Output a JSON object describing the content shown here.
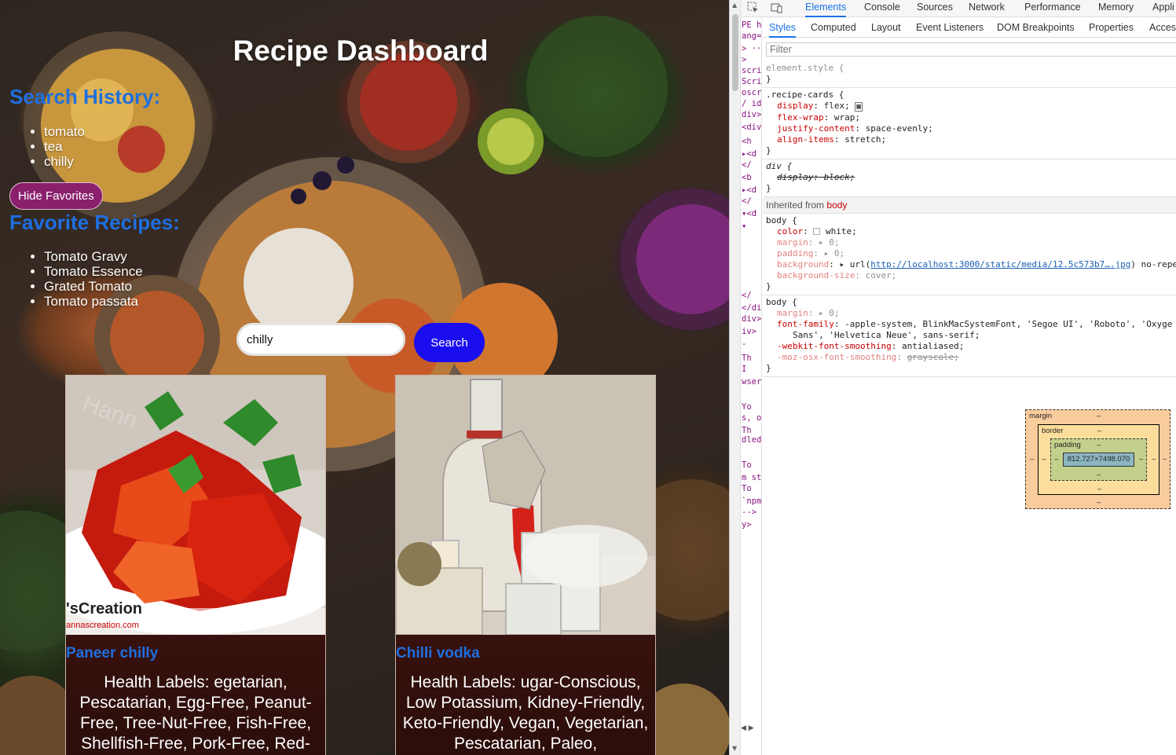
{
  "app": {
    "title": "Recipe Dashboard",
    "search_history": {
      "heading": "Search History:",
      "items": [
        "tomato",
        "tea",
        "chilly"
      ]
    },
    "hide_favorites_label": "Hide Favorites",
    "favorites": {
      "heading": "Favorite Recipes:",
      "items": [
        "Tomato Gravy",
        "Tomato Essence",
        "Grated Tomato",
        "Tomato passata"
      ]
    },
    "search": {
      "value": "chilly",
      "button_label": "Search"
    },
    "cards": [
      {
        "name": "Paneer chilly",
        "health_labels": "Health Labels: egetarian, Pescatarian, Egg-Free, Peanut-Free, Tree-Nut-Free, Fish-Free, Shellfish-Free, Pork-Free, Red-",
        "watermark_top": "Hann",
        "watermark_bottom": "'sCreation",
        "watermark_url": "annascreation.com"
      },
      {
        "name": "Chilli vodka",
        "health_labels": "Health Labels: ugar-Conscious, Low Potassium, Kidney-Friendly, Keto-Friendly, Vegan, Vegetarian, Pescatarian, Paleo,"
      }
    ],
    "colors": {
      "heading_blue": "#1e6fe0",
      "search_button": "#1a0ef0",
      "hide_favorites": "#8b1f6e"
    }
  },
  "devtools": {
    "top_tabs": [
      "Elements",
      "Console",
      "Sources",
      "Network",
      "Performance",
      "Memory",
      "Appli"
    ],
    "active_top_tab": "Elements",
    "sub_tabs": [
      "Styles",
      "Computed",
      "Layout",
      "Event Listeners",
      "DOM Breakpoints",
      "Properties",
      "Access"
    ],
    "active_sub_tab": "Styles",
    "filter_placeholder": "Filter",
    "dom_fragments": [
      "PE h",
      "ang=",
      "> ···",
      ">",
      "scri",
      "Scri",
      "oscri",
      "/ id=",
      "div>",
      "<div",
      "<h",
      "▸<d",
      "</",
      "<b",
      "▸<d",
      "</",
      "▾<d",
      "▾",
      "</",
      "</di",
      "div>",
      "iv>",
      "-",
      "Th",
      "I",
      "wser",
      "Yo",
      "s, o",
      "Th",
      "dled",
      "To",
      "m sta",
      "To",
      "`npm",
      "-->",
      "y>"
    ],
    "rules": {
      "element_style": "element.style {",
      "close": "}",
      "recipe_cards_selector": ".recipe-cards {",
      "recipe_cards_props": [
        {
          "prop": "display",
          "val": "flex;"
        },
        {
          "prop": "flex-wrap",
          "val": "wrap;"
        },
        {
          "prop": "justify-content",
          "val": "space-evenly;"
        },
        {
          "prop": "align-items",
          "val": "stretch;"
        }
      ],
      "div_selector": "div {",
      "div_prop": "display: block;",
      "inherited_label": "Inherited from",
      "inherited_tag": "body",
      "body_selector": "body {",
      "body1_props": [
        {
          "prop": "color",
          "val": "white;"
        },
        {
          "prop": "margin",
          "val": "▸ 0;"
        },
        {
          "prop": "padding",
          "val": "▸ 0;"
        },
        {
          "prop": "background",
          "val": "▸ url("
        },
        {
          "prop": "background-size",
          "val": "cover;"
        }
      ],
      "background_url": "http://localhost:3000/static/media/12.5c573b7….jpg",
      "background_tail": ") no-repe",
      "body2_props": [
        {
          "prop": "margin",
          "val": "▸ 0;"
        },
        {
          "prop": "font-family",
          "val": "-apple-system, BlinkMacSystemFont, 'Segoe UI', 'Roboto', 'Oxyge"
        },
        {
          "prop": "",
          "val": "Sans', 'Helvetica Neue', sans-serif;"
        },
        {
          "prop": "-webkit-font-smoothing",
          "val": "antialiased;"
        },
        {
          "prop": "-moz-osx-font-smoothing",
          "val": "grayscale;"
        }
      ]
    },
    "box_model": {
      "margin_label": "margin",
      "border_label": "border",
      "padding_label": "padding",
      "dash": "–",
      "content_size": "812.727×7498.070"
    }
  }
}
